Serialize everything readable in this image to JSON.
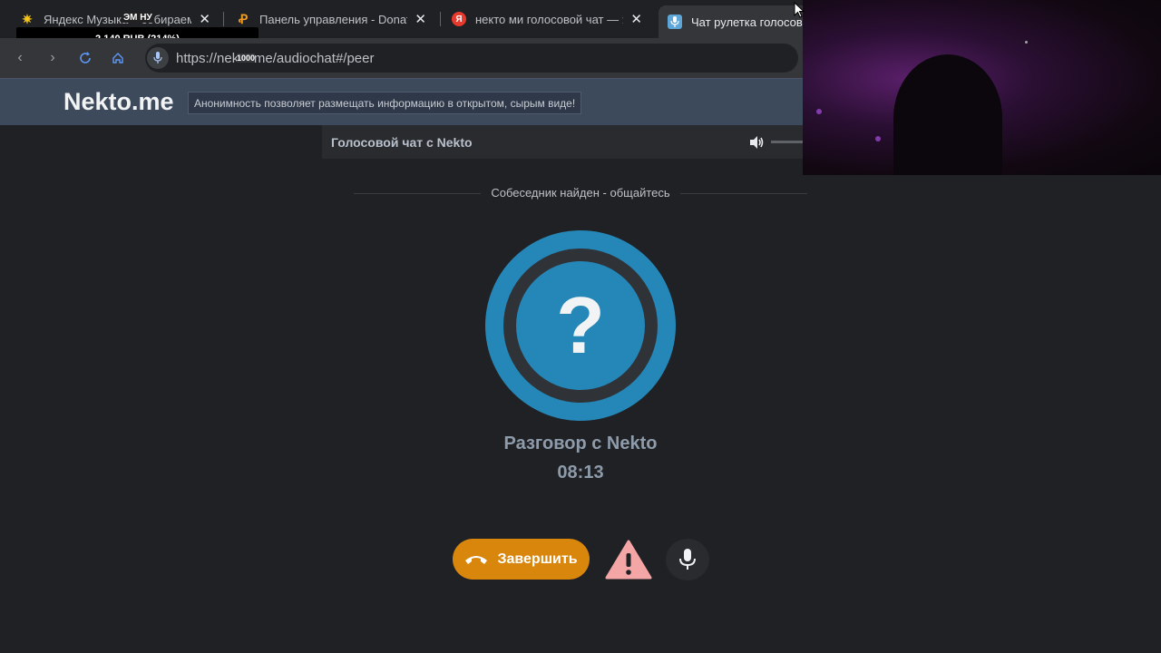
{
  "browser": {
    "tabs": [
      {
        "title": "Яндекс Музыка – собираем м",
        "favicon": "yandex-music-icon",
        "favicon_color": "#f5c518",
        "active": false
      },
      {
        "title": "Панель управления - Donation",
        "favicon": "donationalerts-icon",
        "favicon_color": "#f29b21",
        "active": false
      },
      {
        "title": "некто ми голосовой чат — Ян",
        "favicon": "yandex-icon",
        "favicon_color": "#e63a2e",
        "active": false
      },
      {
        "title": "Чат рулетка голосовая",
        "favicon": "microphone-icon",
        "favicon_color": "#5ea5d8",
        "active": true
      }
    ],
    "url": "https://nekto.me/audiochat#/peer"
  },
  "overlay": {
    "donation_progress": "2 140 RUB (214%)",
    "donation_top": "ЭМ НУ",
    "mini_badge": "1000"
  },
  "site": {
    "logo": "Nekto.me",
    "slogan": "Анонимность позволяет размещать информацию в открытом, сырым виде!"
  },
  "chat": {
    "panel_title": "Голосовой чат с Nekto",
    "status": "Собеседник найден - общайтесь",
    "avatar_symbol": "?",
    "conversation_title": "Разговор с Nekto",
    "timer": "08:13",
    "end_button_label": "Завершить"
  },
  "colors": {
    "accent_blue": "#2586b8",
    "end_button": "#d8860c",
    "warning": "#f4a5a5"
  }
}
